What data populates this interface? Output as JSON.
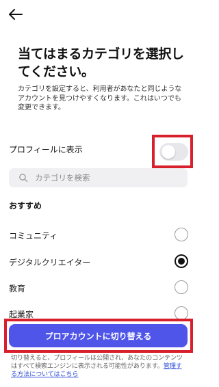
{
  "header": {
    "back_icon": "arrow-left-icon"
  },
  "title": "当てはまるカテゴリを選択してください。",
  "description": "カテゴリを設定すると、利用者があなたと同じようなアカウントを見つけやすくなります。これはいつでも変更できます。",
  "profile_toggle": {
    "label": "プロフィールに表示",
    "on": false
  },
  "search": {
    "placeholder": "カテゴリを検索",
    "icon": "search-icon"
  },
  "section_title": "おすすめ",
  "options": [
    {
      "label": "コミュニティ",
      "selected": false
    },
    {
      "label": "デジタルクリエイター",
      "selected": true
    },
    {
      "label": "教育",
      "selected": false
    },
    {
      "label": "起業家",
      "selected": false
    }
  ],
  "cta_label": "プロアカウントに切り替える",
  "footnote": {
    "text": "切り替えると、プロフィールは公開され、あなたのコンテンツはすべて検索エンジンに表示される可能性があります。",
    "link": "管理する方法についてはこちら"
  },
  "colors": {
    "accent": "#4f55e8",
    "highlight": "#d8202c",
    "link": "#2e4fd6"
  }
}
